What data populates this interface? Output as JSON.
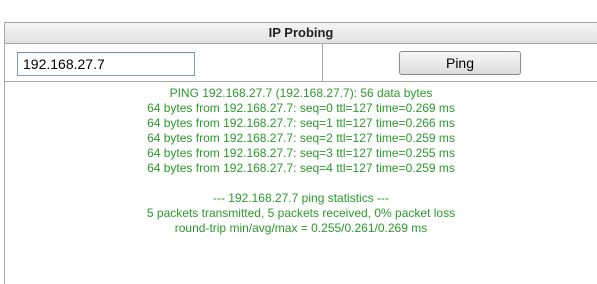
{
  "panel": {
    "title": "IP Probing"
  },
  "form": {
    "ip_value": "192.168.27.7",
    "ping_label": "Ping"
  },
  "output": {
    "lines": [
      "PING 192.168.27.7 (192.168.27.7): 56 data bytes",
      "64 bytes from 192.168.27.7: seq=0 ttl=127 time=0.269 ms",
      "64 bytes from 192.168.27.7: seq=1 ttl=127 time=0.266 ms",
      "64 bytes from 192.168.27.7: seq=2 ttl=127 time=0.259 ms",
      "64 bytes from 192.168.27.7: seq=3 ttl=127 time=0.255 ms",
      "64 bytes from 192.168.27.7: seq=4 ttl=127 time=0.259 ms"
    ],
    "stats_header": "--- 192.168.27.7 ping statistics ---",
    "stats_packets": "5 packets transmitted, 5 packets received, 0% packet loss",
    "stats_rtt": "round-trip min/avg/max = 0.255/0.261/0.269 ms"
  },
  "colors": {
    "output_text": "#2b9a2b",
    "border": "#a9a9a9"
  }
}
